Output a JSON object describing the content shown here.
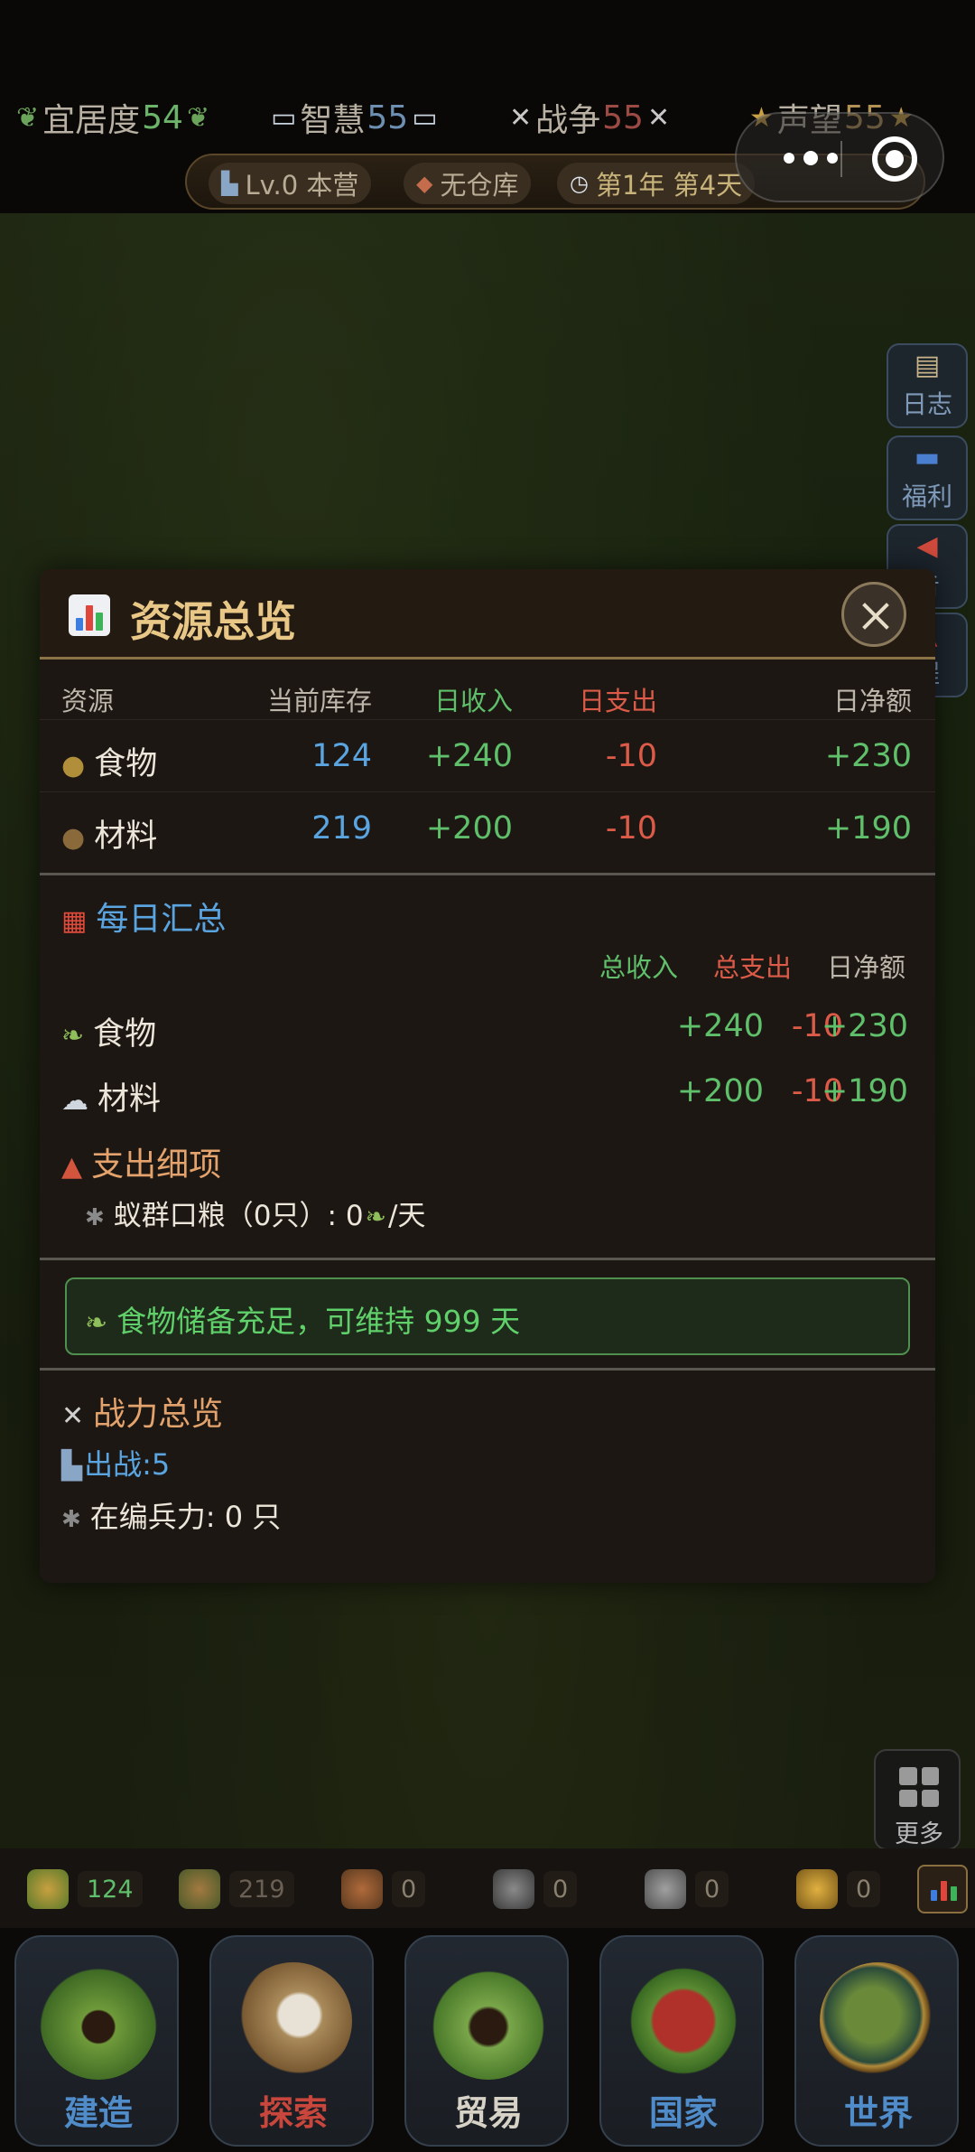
{
  "hud": {
    "stats": [
      {
        "icon": "🌿",
        "label": "宜居度",
        "value": "54",
        "tone": "green"
      },
      {
        "icon": "📖",
        "label": "智慧",
        "value": "55",
        "tone": "blue"
      },
      {
        "icon": "⚔",
        "label": "战争",
        "value": "55",
        "tone": "red"
      },
      {
        "icon": "★",
        "label": "声望",
        "value": "55",
        "tone": "gold"
      }
    ],
    "base_level": "Lv.0 本营",
    "warehouse": "无仓库",
    "date": "第1年 第4天"
  },
  "side_buttons": [
    {
      "label": "日志",
      "icon": "scroll-icon"
    },
    {
      "label": "福利",
      "icon": "gift-icon"
    },
    {
      "label": "告",
      "icon": "megaphone-icon"
    },
    {
      "label": "程",
      "icon": "flag-icon"
    }
  ],
  "more_label": "更多",
  "modal": {
    "title": "资源总览",
    "table": {
      "headers": {
        "name": "资源",
        "stock": "当前库存",
        "income": "日收入",
        "expense": "日支出",
        "net": "日净额"
      },
      "rows": [
        {
          "icon": "🍄",
          "name": "食物",
          "stock": "124",
          "income": "+240",
          "expense": "-10",
          "net": "+230"
        },
        {
          "icon": "🪵",
          "name": "材料",
          "stock": "219",
          "income": "+200",
          "expense": "-10",
          "net": "+190"
        }
      ]
    },
    "daily": {
      "title": "每日汇总",
      "headers": {
        "income": "总收入",
        "expense": "总支出",
        "net": "日净额"
      },
      "rows": [
        {
          "icon": "🍃",
          "name": "食物",
          "income": "+240",
          "expense": "-10",
          "net": "+230"
        },
        {
          "icon": "☁",
          "name": "材料",
          "income": "+200",
          "expense": "-10",
          "net": "+190"
        }
      ]
    },
    "expense_detail": {
      "title": "支出细项",
      "line": "蚁群口粮（0只）: 0",
      "suffix": "/天"
    },
    "notice": "食物储备充足，可维持 999 天",
    "combat": {
      "title": "战力总览",
      "deploy": "出战:5",
      "troops": "在编兵力: 0 只"
    }
  },
  "resource_bar": [
    "124",
    "219",
    "0",
    "0",
    "0",
    "0"
  ],
  "nav": [
    {
      "label": "建造",
      "color": "#4f8cc9"
    },
    {
      "label": "探索",
      "color": "#c8463c"
    },
    {
      "label": "贸易",
      "color": "#d7d2c6"
    },
    {
      "label": "国家",
      "color": "#4f8cc9"
    },
    {
      "label": "世界",
      "color": "#4f8cc9"
    }
  ]
}
